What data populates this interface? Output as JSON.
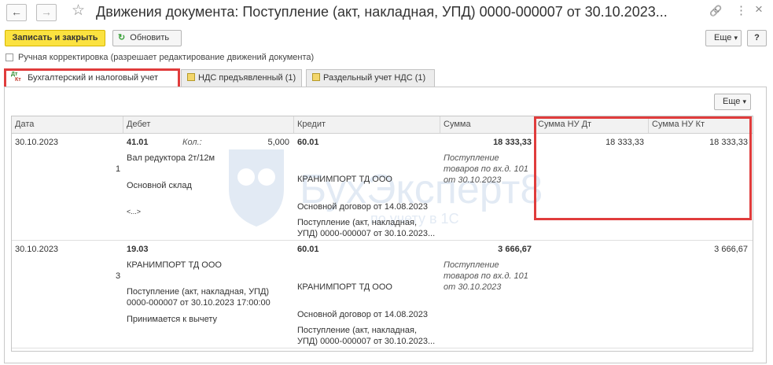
{
  "window": {
    "title": "Движения документа: Поступление (акт, накладная, УПД) 0000-000007 от 30.10.2023...",
    "back_icon": "←",
    "forward_icon": "→",
    "star_icon": "☆",
    "link_icon": "🔗",
    "menu_icon": "⋮",
    "close_icon": "×"
  },
  "toolbar": {
    "save_close": "Записать и закрыть",
    "refresh": "Обновить",
    "refresh_icon": "↻",
    "more": "Еще",
    "more_arrow": "▾",
    "help": "?"
  },
  "manual_edit": {
    "label": "Ручная корректировка (разрешает редактирование движений документа)",
    "checked": false
  },
  "tabs": [
    {
      "label": "Бухгалтерский и налоговый учет",
      "icon": "Дт Кт",
      "active": true
    },
    {
      "label": "НДС предъявленный (1)",
      "active": false
    },
    {
      "label": "Раздельный учет НДС (1)",
      "active": false
    }
  ],
  "panel_more": "Еще",
  "table": {
    "headers": [
      "Дата",
      "Дебет",
      "Кредит",
      "Сумма",
      "Сумма НУ Дт",
      "Сумма НУ Кт"
    ],
    "rows": [
      {
        "date": "30.10.2023",
        "num": "1",
        "debit_account": "41.01",
        "qty_label": "Кол.:",
        "qty": "5,000",
        "debit_sub1": "Вал редуктора 2т/12м",
        "debit_sub2": "Основной склад",
        "debit_sub3": "<...>",
        "credit_account": "60.01",
        "credit_sub1": "КРАНИМПОРТ ТД ООО",
        "credit_sub2": "Основной договор от 14.08.2023",
        "credit_sub3a": "Поступление (акт, накладная,",
        "credit_sub3b": "УПД) 0000-000007 от 30.10.2023...",
        "sum": "18 333,33",
        "content1": "Поступление",
        "content2": "товаров по вх.д. 101",
        "content3": "от 30.10.2023",
        "nu_dt": "18 333,33",
        "nu_kt": "18 333,33"
      },
      {
        "date": "30.10.2023",
        "num": "3",
        "debit_account": "19.03",
        "debit_sub1": "КРАНИМПОРТ ТД ООО",
        "debit_sub2a": "Поступление (акт, накладная, УПД)",
        "debit_sub2b": "0000-000007 от 30.10.2023 17:00:00",
        "debit_sub3": "Принимается к вычету",
        "credit_account": "60.01",
        "credit_sub1": "КРАНИМПОРТ ТД ООО",
        "credit_sub2": "Основной договор от 14.08.2023",
        "credit_sub3a": "Поступление (акт, накладная,",
        "credit_sub3b": "УПД) 0000-000007 от 30.10.2023...",
        "sum": "3 666,67",
        "content1": "Поступление",
        "content2": "товаров по вх.д. 101",
        "content3": "от 30.10.2023",
        "nu_dt": "",
        "nu_kt": "3 666,67"
      }
    ]
  },
  "watermark": {
    "text": "БухЭксперт8",
    "subtext": "по учету в 1С"
  },
  "colors": {
    "primary_button": "#fbe240",
    "highlight": "#e03c3c"
  }
}
